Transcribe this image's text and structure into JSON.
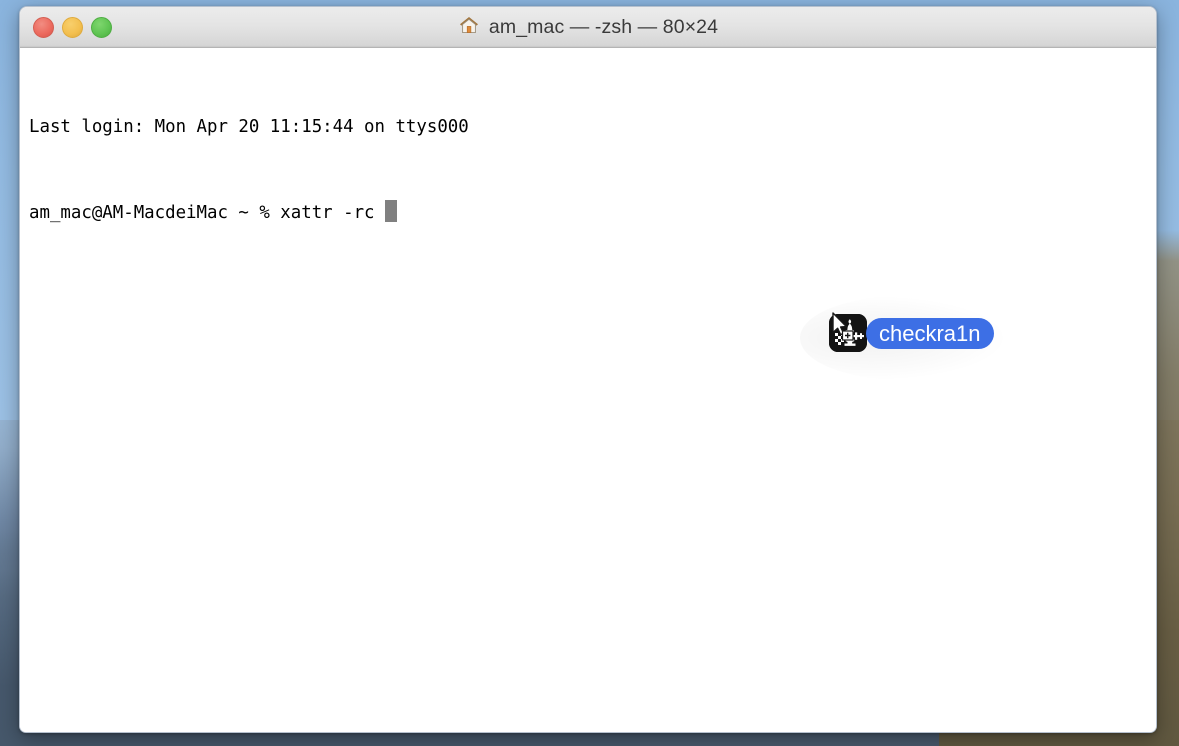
{
  "window": {
    "title": "am_mac — -zsh — 80×24",
    "title_icon": "home-icon",
    "traffic_lights": [
      {
        "name": "close-button",
        "color": "#ec6a5e",
        "label": "Close"
      },
      {
        "name": "minimize-button",
        "color": "#f3bf4f",
        "label": "Minimize"
      },
      {
        "name": "zoom-button",
        "color": "#5fc452",
        "label": "Zoom"
      }
    ]
  },
  "terminal": {
    "line_1": "Last login: Mon Apr 20 11:15:44 on ttys000",
    "line_2_prompt": "am_mac@AM-MacdeiMac ~ % ",
    "line_2_command": "xattr -rc ",
    "cursor": "block",
    "cursor_color": "#808080",
    "foreground": "#000000",
    "background": "#ffffff"
  },
  "drag_item": {
    "label": "checkra1n",
    "icon_name": "checkra1n-app-icon",
    "label_background": "#3d6fe5",
    "label_color": "#ffffff",
    "icon_background": "#141414",
    "cursor_name": "drag-copy-cursor"
  },
  "desktop": {
    "wallpaper_name": "mountain-lake-wallpaper",
    "sky_color": "#8ab4de",
    "water_color": "#506478",
    "ridge_color": "#6e603e"
  }
}
